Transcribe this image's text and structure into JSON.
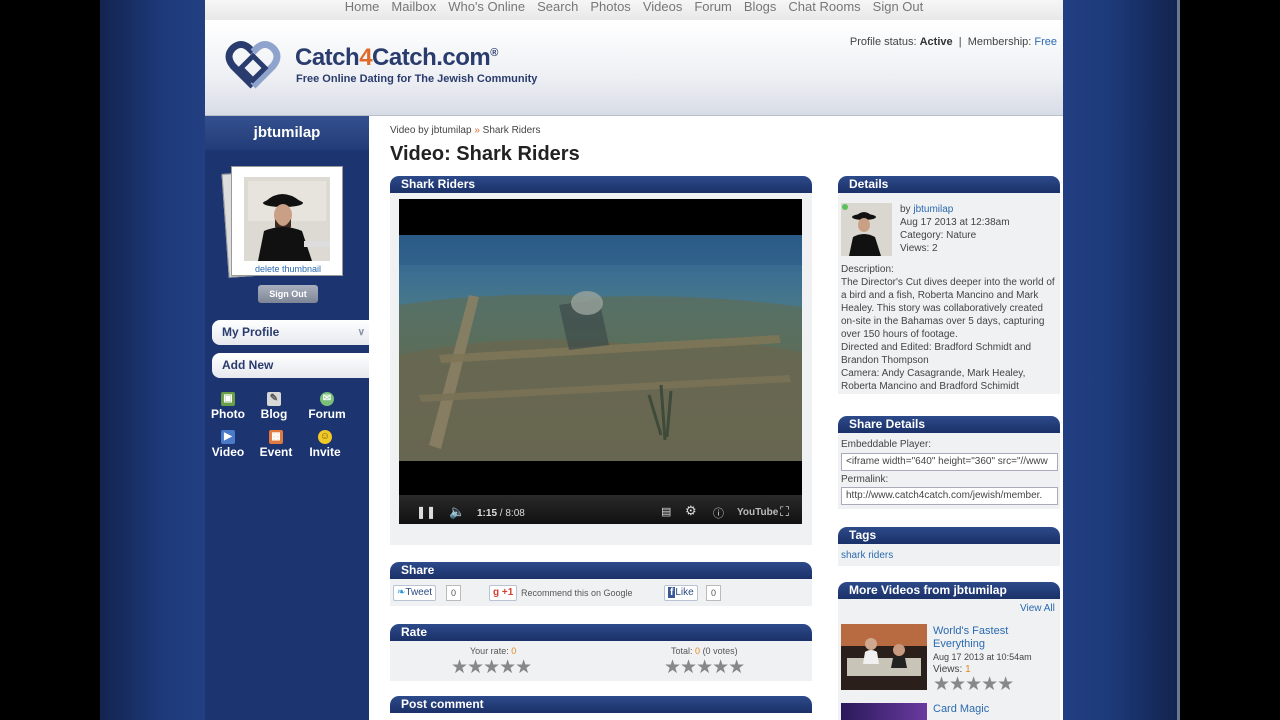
{
  "topnav": [
    "Home",
    "Mailbox",
    "Who's Online",
    "Search",
    "Photos",
    "Videos",
    "Forum",
    "Blogs",
    "Chat Rooms",
    "Sign Out"
  ],
  "header": {
    "logo_part1": "Catch",
    "logo_part2": "4",
    "logo_part3": "Catch",
    "logo_part4": ".com",
    "logo_reg": "®",
    "tagline": "Free Online Dating for The Jewish Community",
    "status_label": "Profile status:",
    "status_value": "Active",
    "separator": "|",
    "membership_label": "Membership:",
    "membership_value": "Free"
  },
  "sidebar": {
    "username": "jbtumilap",
    "delete_thumb": "delete thumbnail",
    "signout": "Sign Out",
    "my_profile": "My Profile",
    "add_new": "Add New",
    "quick": [
      "Photo",
      "Blog",
      "Forum",
      "Video",
      "Event",
      "Invite"
    ]
  },
  "breadcrumb": {
    "part1": "Video by jbtumilap",
    "sep": "»",
    "part2": "Shark Riders"
  },
  "title": "Video: Shark Riders",
  "video_box": {
    "header": "Shark Riders",
    "time_current": "1:15",
    "time_sep": "/",
    "time_total": "8:08",
    "progress_fraction": 0.154,
    "youtube": "YouTube"
  },
  "share": {
    "header": "Share",
    "tweet": "Tweet",
    "tweet_count": "0",
    "gplus": "+1",
    "recommend": "Recommend this on Google",
    "like": "Like",
    "like_count": "0"
  },
  "rate": {
    "header": "Rate",
    "your_rate_label": "Your rate:",
    "your_rate_value": "0",
    "total_label": "Total:",
    "total_value": "0",
    "total_votes": "(0 votes)",
    "stars": "★★★★★"
  },
  "post_comment": {
    "header": "Post comment"
  },
  "details": {
    "header": "Details",
    "by_label": "by",
    "by_user": "jbtumilap",
    "date": "Aug 17 2013 at 12:38am",
    "category": "Category: Nature",
    "views": "Views: 2",
    "description_label": "Description:",
    "description": "The Director's Cut dives deeper into the world of a bird and a fish, Roberta Mancino and Mark Healey. This story was collaboratively created on-site in the Bahamas over 5 days, capturing over 150 hours of footage.",
    "directed": "Directed and Edited: Bradford Schmidt and Brandon Thompson",
    "camera": "Camera: Andy Casagrande, Mark Healey, Roberta Mancino and Bradford Schimidt"
  },
  "share_details": {
    "header": "Share Details",
    "embed_label": "Embeddable Player:",
    "embed_value": "<iframe width=\"640\" height=\"360\" src=\"//www",
    "permalink_label": "Permalink:",
    "permalink_value": "http://www.catch4catch.com/jewish/member."
  },
  "tags": {
    "header": "Tags",
    "tag": "shark riders"
  },
  "more_videos": {
    "header": "More Videos from jbtumilap",
    "view_all": "View All",
    "items": [
      {
        "title": "World's Fastest Everything",
        "date": "Aug 17 2013 at 10:54am",
        "views_label": "Views:",
        "views": "1",
        "stars": "★★★★★"
      },
      {
        "title": "Card Magic"
      }
    ]
  },
  "colors": {
    "navy": "#1c3470",
    "accent_orange": "#e06a2a",
    "link_blue": "#2a6ab0"
  }
}
